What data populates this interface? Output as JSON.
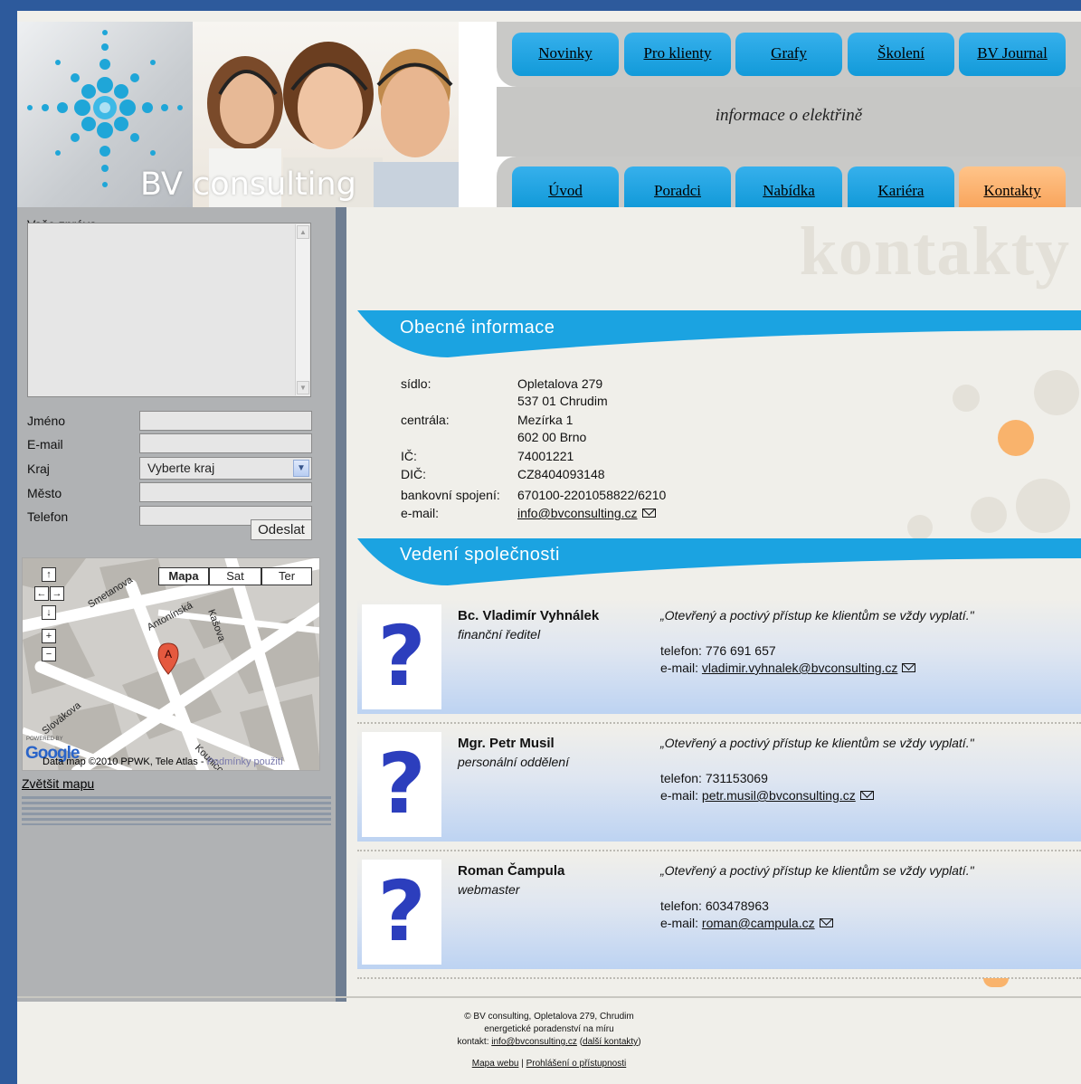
{
  "header": {
    "brand": "BV consulting",
    "tagline": "informace o elektřině",
    "top_nav": [
      "Novinky",
      "Pro klienty",
      "Grafy",
      "Školení",
      "BV Journal"
    ],
    "bottom_nav": [
      "Úvod",
      "Poradci",
      "Nabídka",
      "Kariéra",
      "Kontakty"
    ],
    "active_tab": "Kontakty"
  },
  "form": {
    "message_label": "Vaše zpráva",
    "name_label": "Jméno",
    "email_label": "E-mail",
    "region_label": "Kraj",
    "region_value": "Vyberte kraj",
    "city_label": "Město",
    "phone_label": "Telefon",
    "submit_label": "Odeslat"
  },
  "map": {
    "types": [
      "Mapa",
      "Sat",
      "Ter"
    ],
    "active_type": "Mapa",
    "streets": [
      "Smetanova",
      "Antonínská",
      "Kašova",
      "Slovákova",
      "Kounicova"
    ],
    "marker": "A",
    "powered_by": "POWERED BY",
    "google": "Google",
    "credit": "Data map ©2010 PPWK, Tele Atlas -",
    "terms_link": "Podmínky použití",
    "enlarge_link": "Zvětšit mapu"
  },
  "content": {
    "watermark": "kontakty",
    "general_title": "Obecné informace",
    "info": {
      "seat_label": "sídlo:",
      "seat_line1": "Opletalova 279",
      "seat_line2": "537 01 Chrudim",
      "hq_label": "centrála:",
      "hq_line1": "Mezírka 1",
      "hq_line2": "602 00 Brno",
      "ic_label": "IČ:",
      "ic_value": "74001221",
      "dic_label": "DIČ:",
      "dic_value": "CZ8404093148",
      "bank_label": "bankovní spojení:",
      "bank_value": "670100-2201058822/6210",
      "email_label": "e-mail:",
      "email_value": "info@bvconsulting.cz"
    },
    "management_title": "Vedení společnosti",
    "people": [
      {
        "name": "Bc. Vladimír Vyhnálek",
        "role": "finanční ředitel",
        "quote": "„Otevřený a poctivý přístup ke klientům se vždy vyplatí.\"",
        "phone": "telefon: 776 691 657",
        "email_label": "e-mail:",
        "email": "vladimir.vyhnalek@bvconsulting.cz",
        "placeholder": "?"
      },
      {
        "name": "Mgr. Petr Musil",
        "role": "personální oddělení",
        "quote": "„Otevřený a poctivý přístup ke klientům se vždy vyplatí.\"",
        "phone": "telefon: 731153069",
        "email_label": "e-mail:",
        "email": "petr.musil@bvconsulting.cz",
        "placeholder": "?"
      },
      {
        "name": "Roman Čampula",
        "role": "webmaster",
        "quote": "„Otevřený a poctivý přístup ke klientům se vždy vyplatí.\"",
        "phone": "telefon: 603478963",
        "email_label": "e-mail:",
        "email": "roman@campula.cz",
        "placeholder": "?"
      }
    ]
  },
  "footer": {
    "line1": "© BV consulting, Opletalova 279, Chrudim",
    "line2": "energetické poradenství na míru",
    "contact_prefix": "kontakt:",
    "contact_email": "info@bvconsulting.cz",
    "more_contacts": "další kontakty",
    "sitemap": "Mapa webu",
    "accessibility": "Prohlášení o přístupnosti"
  },
  "colors": {
    "tab_blue": "#1ba3e1",
    "tab_active": "#f9a55d",
    "outer_frame": "#2d5a9c",
    "sidebar": "#b0b2b4"
  }
}
